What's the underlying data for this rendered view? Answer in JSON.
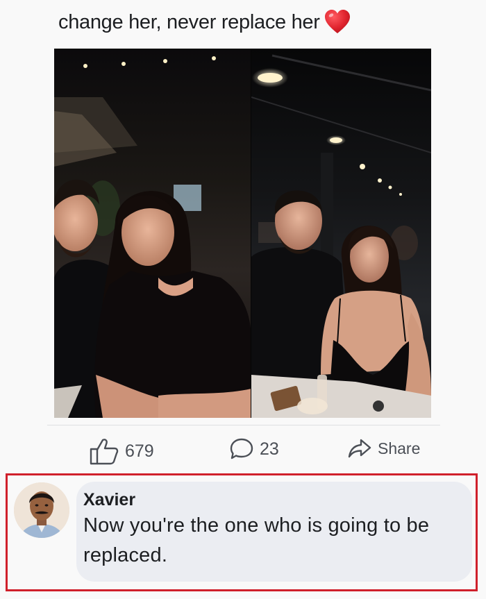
{
  "post": {
    "text": "change her, never replace her",
    "emoji": "heart-emoji"
  },
  "actions": {
    "likes_count": "679",
    "comments_count": "23",
    "share_label": "Share"
  },
  "comment": {
    "author": "Xavier",
    "text": "Now you're the one who is going to be replaced."
  },
  "colors": {
    "highlight_border": "#d0202b",
    "bubble_bg": "#ebedf2",
    "heart": "#e0242e",
    "action_text": "#4b4f56"
  }
}
